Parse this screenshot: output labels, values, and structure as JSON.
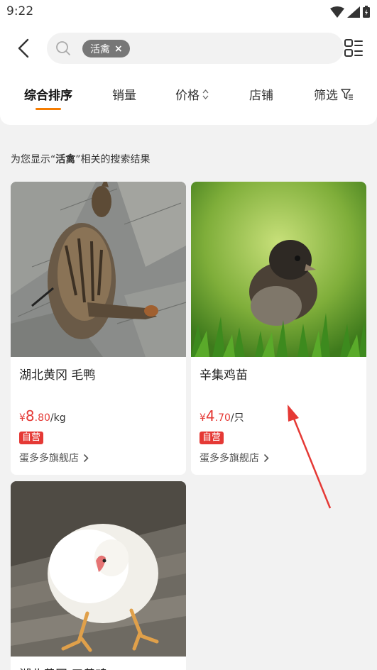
{
  "status_bar": {
    "time": "9:22"
  },
  "search": {
    "chip_label": "活禽"
  },
  "sort_tabs": [
    {
      "label": "综合排序"
    },
    {
      "label": "销量"
    },
    {
      "label": "价格"
    },
    {
      "label": "店铺"
    },
    {
      "label": "筛选"
    }
  ],
  "results_header": {
    "prefix": "为您显示“",
    "keyword": "活禽",
    "suffix": "”相关的搜索结果"
  },
  "products": [
    {
      "title": "湖北黄冈 毛鸭",
      "currency": "¥",
      "price_int": "8",
      "price_dec": ".80",
      "unit": "/kg",
      "badge": "自营",
      "shop": "蛋多多旗舰店"
    },
    {
      "title": "辛集鸡苗",
      "currency": "¥",
      "price_int": "4",
      "price_dec": ".70",
      "unit": "/只",
      "badge": "自营",
      "shop": "蛋多多旗舰店"
    },
    {
      "title": "湖北黄冈 三黄鸡"
    }
  ],
  "icons": [
    "back-arrow-icon",
    "search-icon",
    "close-icon",
    "grid-list-toggle-icon",
    "sort-arrows-icon",
    "filter-icon",
    "chevron-right-icon",
    "wifi-icon",
    "signal-icon",
    "battery-icon"
  ],
  "colors": {
    "accent": "#f57c00",
    "price": "#e53935",
    "annotation_arrow": "#e53935"
  }
}
